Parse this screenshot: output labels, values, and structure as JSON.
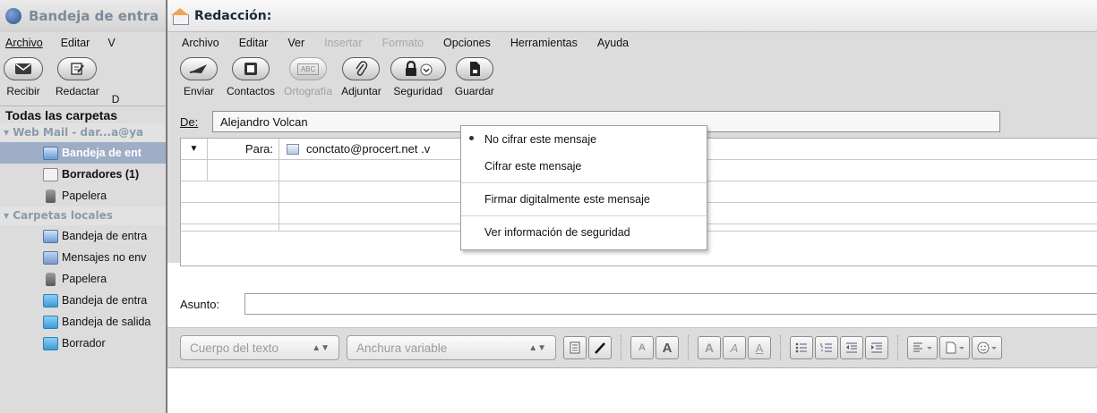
{
  "main_window": {
    "title": "Bandeja de entra",
    "menu": [
      "Archivo",
      "Editar",
      "V"
    ],
    "toolbar": [
      {
        "label": "Recibir",
        "icon": "envelope-icon"
      },
      {
        "label": "Redactar",
        "icon": "compose-icon"
      },
      {
        "label": "D",
        "icon": ""
      }
    ],
    "folders_header": "Todas las carpetas",
    "account": "Web Mail - dar...a@ya",
    "account_folders": [
      {
        "label": "Bandeja de ent",
        "icon": "inbox-icon",
        "selected": true
      },
      {
        "label": "Borradores (1)",
        "icon": "drafts-icon",
        "bold": true
      },
      {
        "label": "Papelera",
        "icon": "trash-icon"
      }
    ],
    "local_header": "Carpetas locales",
    "local_folders": [
      {
        "label": "Bandeja de entra",
        "icon": "inbox-icon"
      },
      {
        "label": "Mensajes no env",
        "icon": "unsent-icon"
      },
      {
        "label": "Papelera",
        "icon": "trash-icon"
      },
      {
        "label": "Bandeja de entra",
        "icon": "folder-icon"
      },
      {
        "label": "Bandeja de salida",
        "icon": "folder-icon"
      },
      {
        "label": "Borrador",
        "icon": "folder-icon"
      }
    ]
  },
  "compose": {
    "title": "Redacción:",
    "menu": [
      {
        "label": "Archivo",
        "disabled": false
      },
      {
        "label": "Editar",
        "disabled": false
      },
      {
        "label": "Ver",
        "disabled": false
      },
      {
        "label": "Insertar",
        "disabled": true
      },
      {
        "label": "Formato",
        "disabled": true
      },
      {
        "label": "Opciones",
        "disabled": false
      },
      {
        "label": "Herramientas",
        "disabled": false
      },
      {
        "label": "Ayuda",
        "disabled": false
      }
    ],
    "toolbar": [
      {
        "label": "Enviar",
        "icon": "send-icon",
        "disabled": false
      },
      {
        "label": "Contactos",
        "icon": "contacts-icon",
        "disabled": false
      },
      {
        "label": "Ortografía",
        "icon": "spellcheck-icon",
        "icon_text": "ABC",
        "disabled": true
      },
      {
        "label": "Adjuntar",
        "icon": "paperclip-icon",
        "disabled": false
      },
      {
        "label": "Seguridad",
        "icon": "lock-icon",
        "disabled": false
      },
      {
        "label": "Guardar",
        "icon": "save-icon",
        "disabled": false
      }
    ],
    "from_label": "De:",
    "from_value": "Alejandro Volcan",
    "to_label": "Para:",
    "to_value": "conctato@procert.net .v",
    "subject_label": "Asunto:",
    "subject_value": "",
    "format": {
      "paragraph_style": "Cuerpo del texto",
      "font": "Anchura variable",
      "a_small": "A",
      "a_large": "A"
    }
  },
  "security_menu": [
    {
      "label": "No cifrar este mensaje",
      "checked": true
    },
    {
      "label": "Cifrar este mensaje",
      "checked": false
    },
    {
      "label": "Firmar digitalmente este mensaje",
      "checked": false,
      "separator_before": true
    },
    {
      "label": "Ver información de seguridad",
      "checked": false,
      "separator_before": true
    }
  ]
}
